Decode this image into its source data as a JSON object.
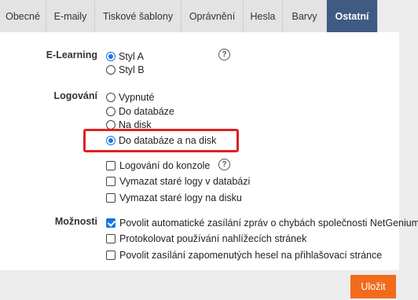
{
  "tabs": [
    {
      "label": "Obecné",
      "active": false
    },
    {
      "label": "E-maily",
      "active": false
    },
    {
      "label": "Tiskové šablony",
      "active": false
    },
    {
      "label": "Oprávnění",
      "active": false
    },
    {
      "label": "Hesla",
      "active": false
    },
    {
      "label": "Barvy",
      "active": false
    },
    {
      "label": "Ostatní",
      "active": true
    }
  ],
  "elearning": {
    "label": "E-Learning",
    "options": [
      {
        "label": "Styl A",
        "checked": true
      },
      {
        "label": "Styl B",
        "checked": false
      }
    ],
    "help_icon": "question-circle-icon"
  },
  "logovani": {
    "label": "Logování",
    "options": [
      {
        "label": "Vypnuté",
        "checked": false
      },
      {
        "label": "Do databáze",
        "checked": false
      },
      {
        "label": "Na disk",
        "checked": false
      },
      {
        "label": "Do databáze a na disk",
        "checked": true
      }
    ],
    "checkboxes": [
      {
        "label": "Logování do konzole",
        "checked": false
      },
      {
        "label": "Vymazat staré logy v databázi",
        "checked": false
      },
      {
        "label": "Vymazat staré logy na disku",
        "checked": false
      }
    ],
    "help_icon": "question-circle-icon"
  },
  "moznosti": {
    "label": "Možnosti",
    "checkboxes": [
      {
        "label": "Povolit automatické zasílání zpráv o chybách společnosti NetGenium",
        "checked": true
      },
      {
        "label": "Protokolovat používání nahlížecích stránek",
        "checked": false
      },
      {
        "label": "Povolit zasílání zapomenutých hesel na přihlašovací stránce",
        "checked": false
      }
    ]
  },
  "save_label": "Uložit",
  "colors": {
    "active_tab": "#3f5a83",
    "accent": "#1a73e8",
    "highlight": "#e02020",
    "save_button": "#f26b1d"
  }
}
